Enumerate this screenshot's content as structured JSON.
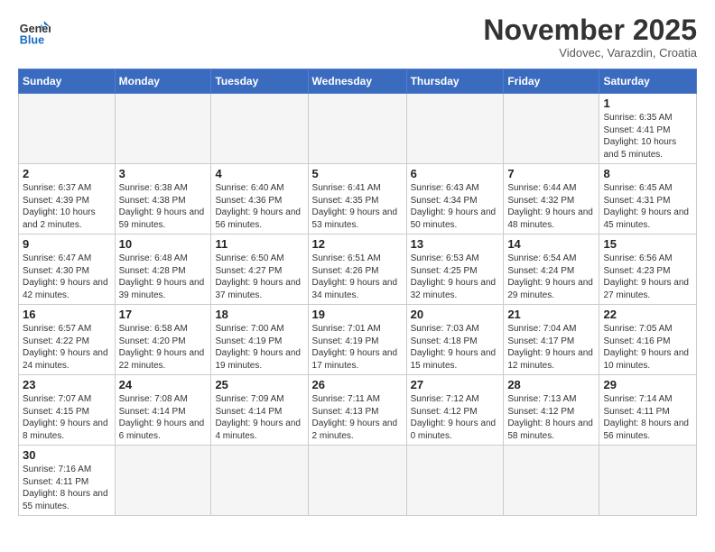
{
  "logo": {
    "general": "General",
    "blue": "Blue"
  },
  "title": "November 2025",
  "subtitle": "Vidovec, Varazdin, Croatia",
  "weekdays": [
    "Sunday",
    "Monday",
    "Tuesday",
    "Wednesday",
    "Thursday",
    "Friday",
    "Saturday"
  ],
  "weeks": [
    [
      null,
      null,
      null,
      null,
      null,
      null,
      {
        "day": "1",
        "sunrise": "6:35 AM",
        "sunset": "4:41 PM",
        "daylight": "10 hours and 5 minutes."
      }
    ],
    [
      {
        "day": "2",
        "sunrise": "6:37 AM",
        "sunset": "4:39 PM",
        "daylight": "10 hours and 2 minutes."
      },
      {
        "day": "3",
        "sunrise": "6:38 AM",
        "sunset": "4:38 PM",
        "daylight": "9 hours and 59 minutes."
      },
      {
        "day": "4",
        "sunrise": "6:40 AM",
        "sunset": "4:36 PM",
        "daylight": "9 hours and 56 minutes."
      },
      {
        "day": "5",
        "sunrise": "6:41 AM",
        "sunset": "4:35 PM",
        "daylight": "9 hours and 53 minutes."
      },
      {
        "day": "6",
        "sunrise": "6:43 AM",
        "sunset": "4:34 PM",
        "daylight": "9 hours and 50 minutes."
      },
      {
        "day": "7",
        "sunrise": "6:44 AM",
        "sunset": "4:32 PM",
        "daylight": "9 hours and 48 minutes."
      },
      {
        "day": "8",
        "sunrise": "6:45 AM",
        "sunset": "4:31 PM",
        "daylight": "9 hours and 45 minutes."
      }
    ],
    [
      {
        "day": "9",
        "sunrise": "6:47 AM",
        "sunset": "4:30 PM",
        "daylight": "9 hours and 42 minutes."
      },
      {
        "day": "10",
        "sunrise": "6:48 AM",
        "sunset": "4:28 PM",
        "daylight": "9 hours and 39 minutes."
      },
      {
        "day": "11",
        "sunrise": "6:50 AM",
        "sunset": "4:27 PM",
        "daylight": "9 hours and 37 minutes."
      },
      {
        "day": "12",
        "sunrise": "6:51 AM",
        "sunset": "4:26 PM",
        "daylight": "9 hours and 34 minutes."
      },
      {
        "day": "13",
        "sunrise": "6:53 AM",
        "sunset": "4:25 PM",
        "daylight": "9 hours and 32 minutes."
      },
      {
        "day": "14",
        "sunrise": "6:54 AM",
        "sunset": "4:24 PM",
        "daylight": "9 hours and 29 minutes."
      },
      {
        "day": "15",
        "sunrise": "6:56 AM",
        "sunset": "4:23 PM",
        "daylight": "9 hours and 27 minutes."
      }
    ],
    [
      {
        "day": "16",
        "sunrise": "6:57 AM",
        "sunset": "4:22 PM",
        "daylight": "9 hours and 24 minutes."
      },
      {
        "day": "17",
        "sunrise": "6:58 AM",
        "sunset": "4:20 PM",
        "daylight": "9 hours and 22 minutes."
      },
      {
        "day": "18",
        "sunrise": "7:00 AM",
        "sunset": "4:19 PM",
        "daylight": "9 hours and 19 minutes."
      },
      {
        "day": "19",
        "sunrise": "7:01 AM",
        "sunset": "4:19 PM",
        "daylight": "9 hours and 17 minutes."
      },
      {
        "day": "20",
        "sunrise": "7:03 AM",
        "sunset": "4:18 PM",
        "daylight": "9 hours and 15 minutes."
      },
      {
        "day": "21",
        "sunrise": "7:04 AM",
        "sunset": "4:17 PM",
        "daylight": "9 hours and 12 minutes."
      },
      {
        "day": "22",
        "sunrise": "7:05 AM",
        "sunset": "4:16 PM",
        "daylight": "9 hours and 10 minutes."
      }
    ],
    [
      {
        "day": "23",
        "sunrise": "7:07 AM",
        "sunset": "4:15 PM",
        "daylight": "9 hours and 8 minutes."
      },
      {
        "day": "24",
        "sunrise": "7:08 AM",
        "sunset": "4:14 PM",
        "daylight": "9 hours and 6 minutes."
      },
      {
        "day": "25",
        "sunrise": "7:09 AM",
        "sunset": "4:14 PM",
        "daylight": "9 hours and 4 minutes."
      },
      {
        "day": "26",
        "sunrise": "7:11 AM",
        "sunset": "4:13 PM",
        "daylight": "9 hours and 2 minutes."
      },
      {
        "day": "27",
        "sunrise": "7:12 AM",
        "sunset": "4:12 PM",
        "daylight": "9 hours and 0 minutes."
      },
      {
        "day": "28",
        "sunrise": "7:13 AM",
        "sunset": "4:12 PM",
        "daylight": "8 hours and 58 minutes."
      },
      {
        "day": "29",
        "sunrise": "7:14 AM",
        "sunset": "4:11 PM",
        "daylight": "8 hours and 56 minutes."
      }
    ],
    [
      {
        "day": "30",
        "sunrise": "7:16 AM",
        "sunset": "4:11 PM",
        "daylight": "8 hours and 55 minutes."
      },
      null,
      null,
      null,
      null,
      null,
      null
    ]
  ]
}
